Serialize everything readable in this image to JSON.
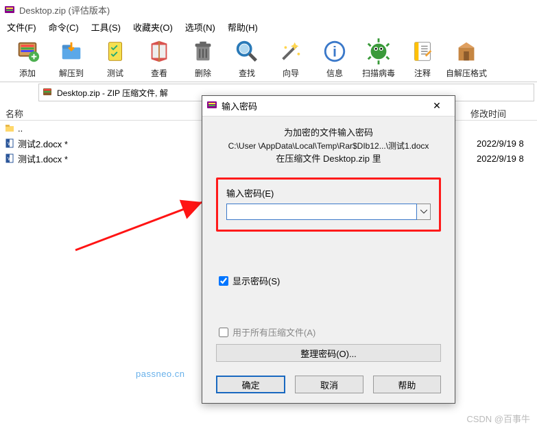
{
  "window": {
    "title": "Desktop.zip (评估版本)"
  },
  "menus": [
    "文件(F)",
    "命令(C)",
    "工具(S)",
    "收藏夹(O)",
    "选项(N)",
    "帮助(H)"
  ],
  "toolbar": [
    {
      "id": "add",
      "label": "添加"
    },
    {
      "id": "extract",
      "label": "解压到"
    },
    {
      "id": "test",
      "label": "测试"
    },
    {
      "id": "view",
      "label": "查看"
    },
    {
      "id": "delete",
      "label": "删除"
    },
    {
      "id": "find",
      "label": "查找"
    },
    {
      "id": "wizard",
      "label": "向导"
    },
    {
      "id": "info",
      "label": "信息"
    },
    {
      "id": "virus",
      "label": "扫描病毒"
    },
    {
      "id": "comment",
      "label": "注释"
    },
    {
      "id": "sfx",
      "label": "自解压格式"
    }
  ],
  "breadcrumb": "Desktop.zip - ZIP 压缩文件, 解",
  "columns": {
    "name": "名称",
    "date": "修改时间"
  },
  "files": [
    {
      "name": "..",
      "date": "",
      "type": "folder"
    },
    {
      "name": "测试2.docx *",
      "date": "2022/9/19 8",
      "type": "docx"
    },
    {
      "name": "测试1.docx *",
      "date": "2022/9/19 8",
      "type": "docx"
    }
  ],
  "dialog": {
    "title": "输入密码",
    "line1": "为加密的文件输入密码",
    "line2": "C:\\User               \\AppData\\Local\\Temp\\Rar$DIb12...\\测试1.docx",
    "line3": "在压缩文件 Desktop.zip 里",
    "input_label": "输入密码(E)",
    "input_value": "",
    "show_password": "显示密码(S)",
    "show_password_checked": true,
    "use_for_all": "用于所有压缩文件(A)",
    "use_for_all_checked": false,
    "organize": "整理密码(O)...",
    "ok": "确定",
    "cancel": "取消",
    "help": "帮助"
  },
  "watermarks": {
    "w1": "passneo.cn",
    "w2": "CSDN @百事牛"
  }
}
